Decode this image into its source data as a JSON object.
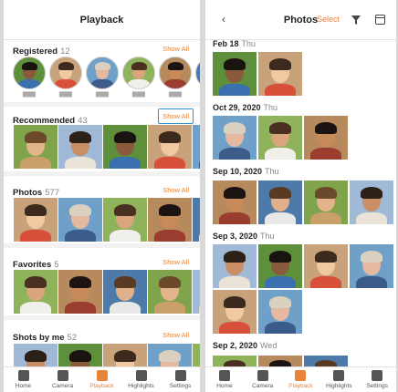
{
  "left": {
    "title": "Playback",
    "sections": [
      {
        "label": "Registered",
        "count": "12",
        "show_all": "Show All"
      },
      {
        "label": "Recommended",
        "count": "43",
        "show_all": "Show All"
      },
      {
        "label": "Photos",
        "count": "577",
        "show_all": "Show All"
      },
      {
        "label": "Favorites",
        "count": "5",
        "show_all": "Show All"
      },
      {
        "label": "Shots by me",
        "count": "52",
        "show_all": "Show All"
      }
    ]
  },
  "right": {
    "title": "Photos",
    "select": "Select",
    "dates": [
      {
        "date": "Feb 18",
        "day": "Thu"
      },
      {
        "date": "Oct 29, 2020",
        "day": "Thu"
      },
      {
        "date": "Sep 10, 2020",
        "day": "Thu"
      },
      {
        "date": "Sep 3, 2020",
        "day": "Thu"
      },
      {
        "date": "Sep 2, 2020",
        "day": "Wed"
      }
    ]
  },
  "tabs": [
    {
      "label": "Home",
      "icon": "home-icon"
    },
    {
      "label": "Camera",
      "icon": "camera-icon"
    },
    {
      "label": "Playback",
      "icon": "playback-icon"
    },
    {
      "label": "Highlights",
      "icon": "highlights-icon"
    },
    {
      "label": "Settings",
      "icon": "settings-icon"
    }
  ],
  "active_tab": "Playback",
  "colors": {
    "accent": "#e8833a",
    "focus": "#2f8fd1"
  }
}
